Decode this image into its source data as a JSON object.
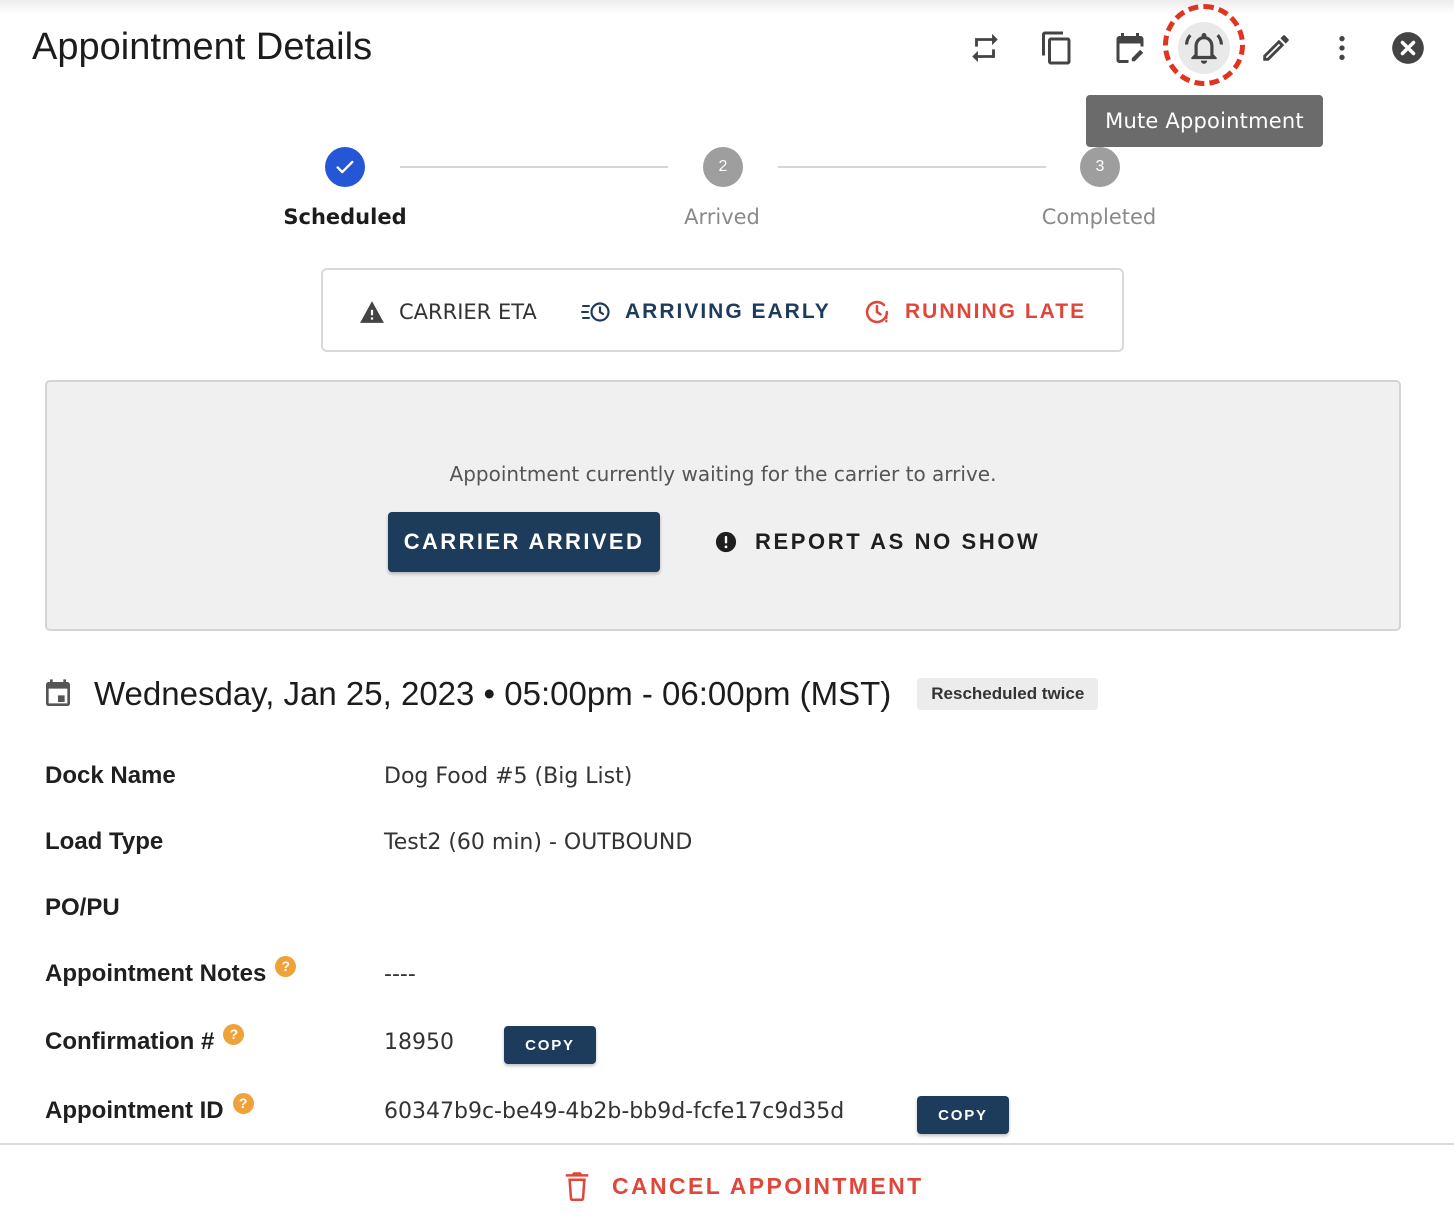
{
  "header": {
    "title": "Appointment Details",
    "tooltip": "Mute Appointment",
    "icons": [
      "swap-icon",
      "copy-icon",
      "reschedule-icon",
      "bell-icon",
      "pencil-icon",
      "more-vert-icon",
      "close-icon"
    ]
  },
  "stepper": {
    "steps": [
      {
        "label": "Scheduled",
        "number": "",
        "state": "done"
      },
      {
        "label": "Arrived",
        "number": "2",
        "state": "pending"
      },
      {
        "label": "Completed",
        "number": "3",
        "state": "pending"
      }
    ]
  },
  "eta": {
    "carrier_eta": "CARRIER ETA",
    "arriving_early": "ARRIVING EARLY",
    "running_late": "RUNNING LATE"
  },
  "status_panel": {
    "message": "Appointment currently waiting for the carrier to arrive.",
    "arrived_button": "CARRIER ARRIVED",
    "no_show_button": "REPORT AS NO SHOW"
  },
  "schedule": {
    "datetime": "Wednesday, Jan 25, 2023  •  05:00pm - 06:00pm (MST)",
    "badge": "Rescheduled twice"
  },
  "details": {
    "dock_name_label": "Dock Name",
    "dock_name_value": "Dog Food #5 (Big List)",
    "load_type_label": "Load Type",
    "load_type_value": "Test2 (60 min) - OUTBOUND",
    "po_label": "PO/PU",
    "notes_label": "Appointment Notes",
    "notes_value": "----",
    "confirmation_label": "Confirmation #",
    "confirmation_value": "18950",
    "appointment_id_label": "Appointment ID",
    "appointment_id_value": "60347b9c-be49-4b2b-bb9d-fcfe17c9d35d",
    "copy_label": "COPY",
    "help_glyph": "?"
  },
  "footer": {
    "cancel_label": "CANCEL APPOINTMENT"
  },
  "colors": {
    "primary": "#1d3b5b",
    "step_done": "#2456d6",
    "step_pending": "#9e9e9e",
    "late": "#e0473b",
    "help": "#f0a23a",
    "highlight_ring": "#e0341f"
  }
}
